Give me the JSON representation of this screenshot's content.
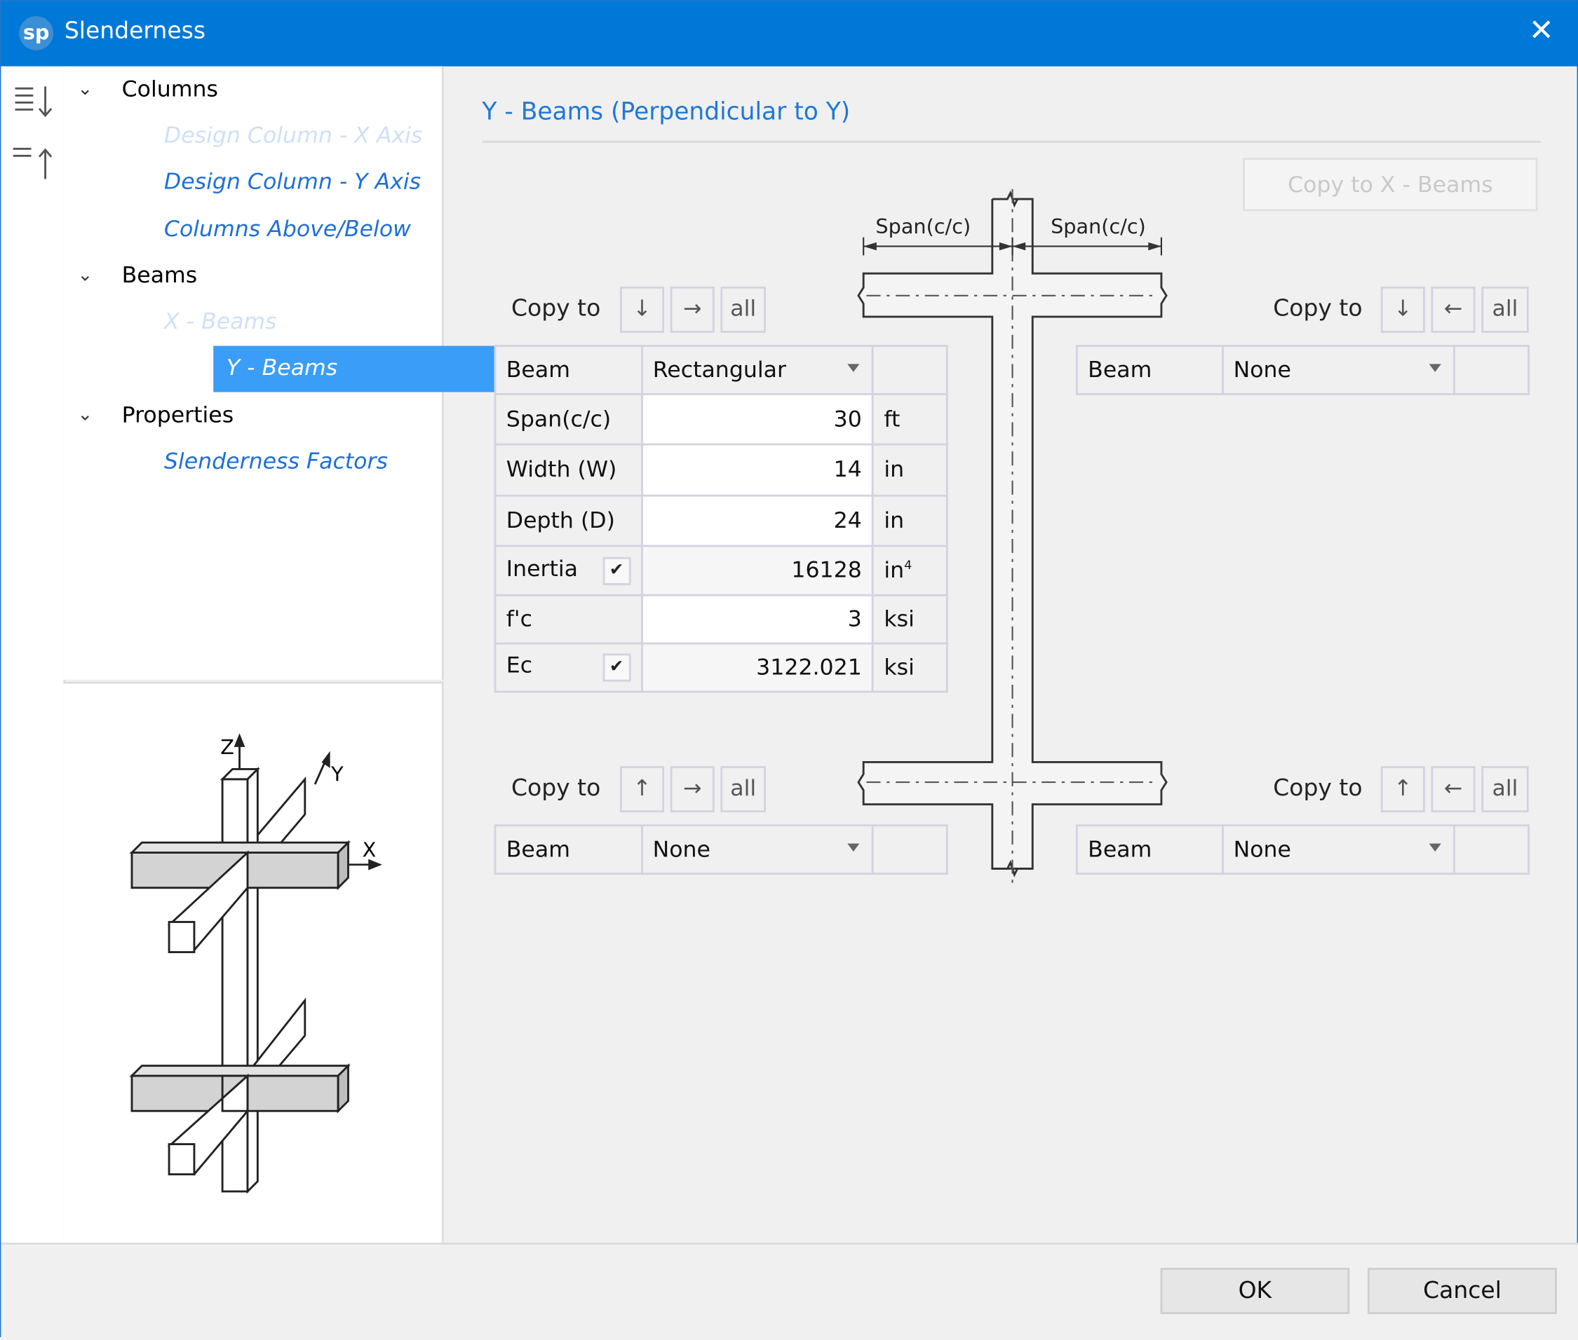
{
  "window": {
    "title": "Slenderness",
    "logo_text": "sp",
    "close_icon": "close-icon"
  },
  "toolstrip": {
    "expand_icon": "expand-all-icon",
    "collapse_icon": "collapse-all-icon"
  },
  "tree": {
    "groups": [
      {
        "label": "Columns",
        "items": [
          {
            "label": "Design Column - X Axis",
            "state": "disabled"
          },
          {
            "label": "Design Column - Y Axis",
            "state": "normal"
          },
          {
            "label": "Columns Above/Below",
            "state": "normal"
          }
        ]
      },
      {
        "label": "Beams",
        "items": [
          {
            "label": "X - Beams",
            "state": "disabled"
          },
          {
            "label": "Y - Beams",
            "state": "selected"
          }
        ]
      },
      {
        "label": "Properties",
        "items": [
          {
            "label": "Slenderness Factors",
            "state": "normal"
          }
        ]
      }
    ]
  },
  "illustration": {
    "axis_z": "Z",
    "axis_y": "Y",
    "axis_x": "X"
  },
  "main": {
    "heading": "Y - Beams (Perpendicular to Y)",
    "copy_to_x_beams": "Copy to X - Beams",
    "diagram": {
      "span_left": "Span(c/c)",
      "span_right": "Span(c/c)"
    },
    "top_left": {
      "copy_label": "Copy to",
      "buttons": [
        "↓",
        "→",
        "all"
      ],
      "beam_label": "Beam",
      "beam_type": "Rectangular",
      "rows": [
        {
          "label": "Span(c/c)",
          "value": "30",
          "unit": "ft"
        },
        {
          "label": "Width (W)",
          "value": "14",
          "unit": "in"
        },
        {
          "label": "Depth (D)",
          "value": "24",
          "unit": "in"
        },
        {
          "label": "Inertia",
          "value": "16128",
          "unit": "in",
          "unit_sup": "4",
          "checked": true
        },
        {
          "label": "f'c",
          "value": "3",
          "unit": "ksi"
        },
        {
          "label": "Ec",
          "value": "3122.021",
          "unit": "ksi",
          "checked": true
        }
      ]
    },
    "top_right": {
      "copy_label": "Copy to",
      "buttons": [
        "↓",
        "←",
        "all"
      ],
      "beam_label": "Beam",
      "beam_type": "None"
    },
    "bottom_left": {
      "copy_label": "Copy to",
      "buttons": [
        "↑",
        "→",
        "all"
      ],
      "beam_label": "Beam",
      "beam_type": "None"
    },
    "bottom_right": {
      "copy_label": "Copy to",
      "buttons": [
        "↑",
        "←",
        "all"
      ],
      "beam_label": "Beam",
      "beam_type": "None"
    }
  },
  "footer": {
    "ok": "OK",
    "cancel": "Cancel"
  },
  "colors": {
    "titlebar": "#0078d7",
    "accent": "#1e78d7",
    "selection": "#3a9df8"
  }
}
